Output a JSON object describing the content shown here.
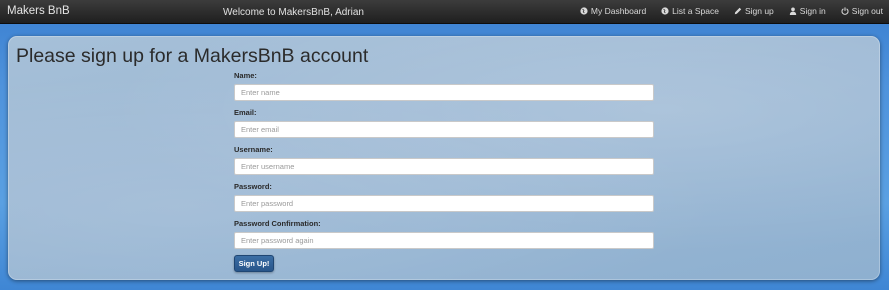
{
  "navbar": {
    "brand": "Makers BnB",
    "welcome": "Welcome to MakersBnB, Adrian",
    "links": [
      {
        "label": "My Dashboard",
        "icon": "globe-icon"
      },
      {
        "label": "List a Space",
        "icon": "globe-icon"
      },
      {
        "label": "Sign up",
        "icon": "pencil-icon"
      },
      {
        "label": "Sign in",
        "icon": "user-icon"
      },
      {
        "label": "Sign out",
        "icon": "power-icon"
      }
    ]
  },
  "page": {
    "title": "Please sign up for a MakersBnB account"
  },
  "form": {
    "fields": [
      {
        "label": "Name:",
        "placeholder": "Enter name",
        "value": ""
      },
      {
        "label": "Email:",
        "placeholder": "Enter email",
        "value": ""
      },
      {
        "label": "Username:",
        "placeholder": "Enter username",
        "value": ""
      },
      {
        "label": "Password:",
        "placeholder": "Enter password",
        "value": ""
      },
      {
        "label": "Password Confirmation:",
        "placeholder": "Enter password again",
        "value": ""
      }
    ],
    "submit_label": "Sign Up!"
  },
  "colors": {
    "navbar_bg": "#2a2a2a",
    "background_blue": "#4f93dc",
    "button_blue": "#2f5f96"
  }
}
